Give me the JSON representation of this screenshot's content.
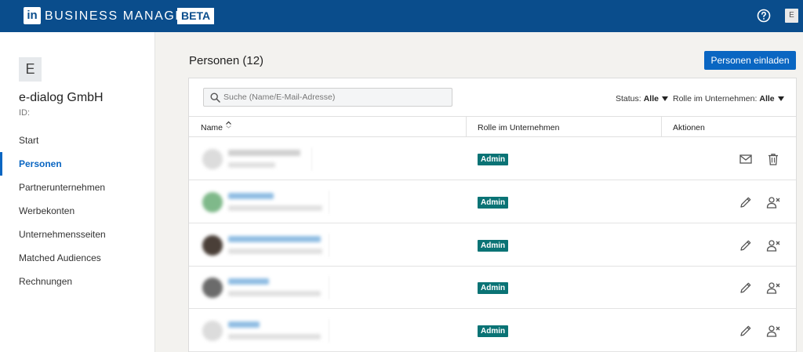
{
  "topbar": {
    "logo": "in",
    "brand": "BUSINESS MANAGER",
    "badge": "BETA",
    "user_initial": "E",
    "help_icon": "question-circle-icon"
  },
  "sidebar": {
    "company_initial": "E",
    "company_name": "e-dialog GmbH",
    "id_label": "ID:",
    "items": [
      {
        "label": "Start",
        "active": false
      },
      {
        "label": "Personen",
        "active": true
      },
      {
        "label": "Partnerunternehmen",
        "active": false
      },
      {
        "label": "Werbekonten",
        "active": false
      },
      {
        "label": "Unternehmensseiten",
        "active": false
      },
      {
        "label": "Matched Audiences",
        "active": false
      },
      {
        "label": "Rechnungen",
        "active": false
      }
    ]
  },
  "main": {
    "title": "Personen (12)",
    "invite_label": "Personen einladen",
    "search_placeholder": "Suche (Name/E-Mail-Adresse)",
    "filters": {
      "status_label": "Status:",
      "status_value": "Alle",
      "role_label": "Rolle im Unternehmen:",
      "role_value": "Alle"
    },
    "columns": {
      "name": "Name",
      "role": "Rolle im Unternehmen",
      "actions": "Aktionen"
    },
    "rows": [
      {
        "role": "Admin",
        "actions": [
          "mail-icon",
          "trash-icon"
        ]
      },
      {
        "role": "Admin",
        "actions": [
          "pencil-icon",
          "remove-user-icon"
        ]
      },
      {
        "role": "Admin",
        "actions": [
          "pencil-icon",
          "remove-user-icon"
        ]
      },
      {
        "role": "Admin",
        "actions": [
          "pencil-icon",
          "remove-user-icon"
        ]
      },
      {
        "role": "Admin",
        "actions": [
          "pencil-icon",
          "remove-user-icon"
        ]
      }
    ]
  },
  "colors": {
    "topbar": "#0a4d8c",
    "accent": "#0a66c2",
    "badge": "#0a7375"
  }
}
